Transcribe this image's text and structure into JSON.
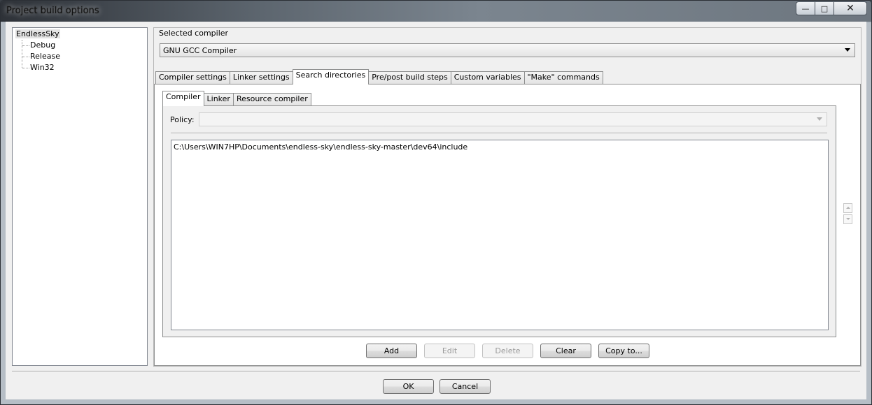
{
  "window": {
    "title": "Project build options",
    "min_glyph": "—",
    "max_glyph": "□",
    "close_glyph": "✕"
  },
  "tree": {
    "root": "EndlessSky",
    "items": [
      "Debug",
      "Release",
      "Win32"
    ]
  },
  "compiler": {
    "label": "Selected compiler",
    "value": "GNU GCC Compiler"
  },
  "main_tabs": [
    {
      "label": "Compiler settings"
    },
    {
      "label": "Linker settings"
    },
    {
      "label": "Search directories"
    },
    {
      "label": "Pre/post build steps"
    },
    {
      "label": "Custom variables"
    },
    {
      "label": "\"Make\" commands"
    }
  ],
  "main_active_tab": "Search directories",
  "sub_tabs": [
    {
      "label": "Compiler"
    },
    {
      "label": "Linker"
    },
    {
      "label": "Resource compiler"
    }
  ],
  "sub_active_tab": "Compiler",
  "policy": {
    "label": "Policy:",
    "value": ""
  },
  "directories": [
    "C:\\Users\\WIN7HP\\Documents\\endless-sky\\endless-sky-master\\dev64\\include"
  ],
  "buttons": {
    "add": "Add",
    "edit": "Edit",
    "delete": "Delete",
    "clear": "Clear",
    "copy_to": "Copy to...",
    "ok": "OK",
    "cancel": "Cancel"
  }
}
